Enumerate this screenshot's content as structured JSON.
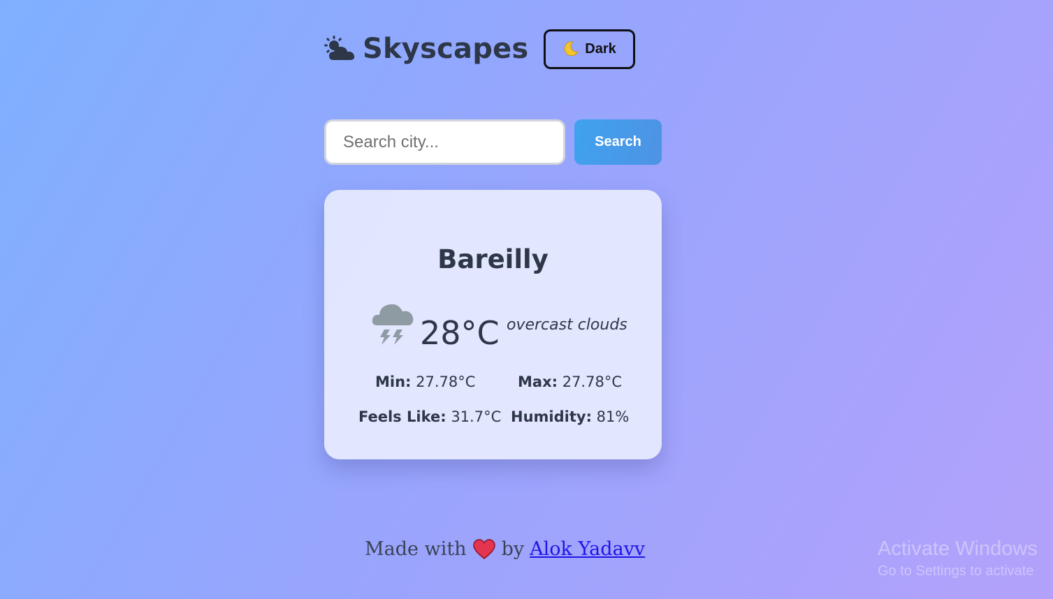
{
  "header": {
    "app_title": "Skyscapes",
    "brand_icon": "sun-behind-cloud-icon",
    "theme_toggle": {
      "icon": "moon-icon",
      "label": "Dark"
    }
  },
  "search": {
    "placeholder": "Search city...",
    "value": "",
    "button_label": "Search"
  },
  "weather": {
    "city": "Bareilly",
    "icon": "thunder-cloud-icon",
    "temperature": "28°C",
    "description": "overcast clouds",
    "stats": {
      "min": {
        "label": "Min:",
        "value": "27.78°C"
      },
      "max": {
        "label": "Max:",
        "value": "27.78°C"
      },
      "feels_like": {
        "label": "Feels Like:",
        "value": "31.7°C"
      },
      "humidity": {
        "label": "Humidity:",
        "value": "81%"
      }
    }
  },
  "footer": {
    "prefix": "Made with",
    "icon": "heart-icon",
    "by": "by",
    "author": "Alok Yadavv"
  },
  "watermark": {
    "title": "Activate Windows",
    "subtitle": "Go to Settings to activate"
  },
  "colors": {
    "background_start": "#7fb0ff",
    "background_end": "#b3a1fb",
    "search_button": "#3fa2ee",
    "text_primary": "#2d3748",
    "link": "#1f14e8"
  }
}
